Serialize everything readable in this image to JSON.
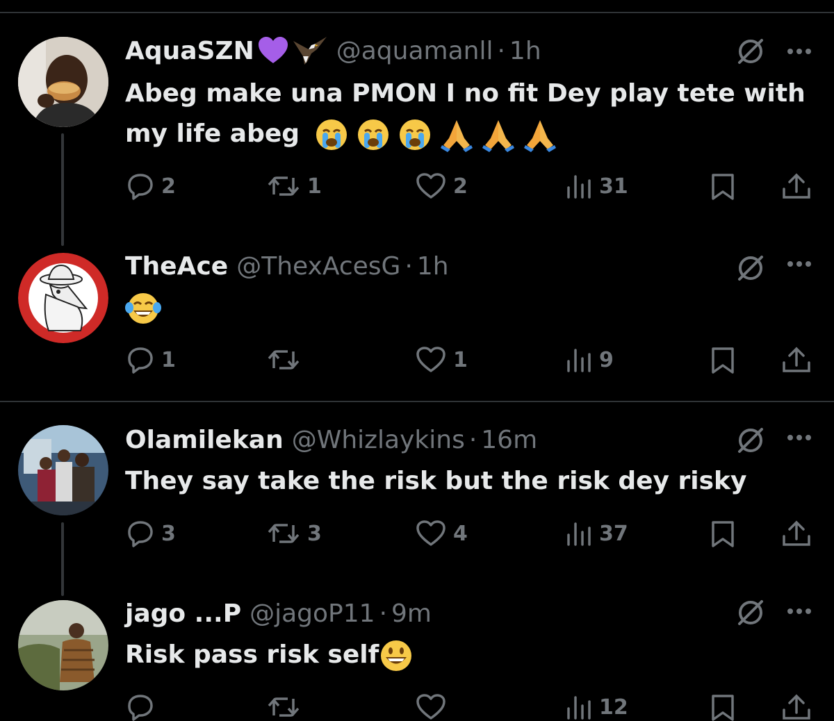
{
  "tweets": [
    {
      "name": "AquaSZN",
      "handle": "@aquamanll",
      "dot": "·",
      "time": "1h",
      "text": "Abeg make una PMON I no fit Dey play tete with my life abeg",
      "emojis": [
        "crying-face",
        "crying-face",
        "crying-face",
        "folded-hands",
        "folded-hands",
        "folded-hands"
      ],
      "counts": {
        "replies": "2",
        "reposts": "1",
        "likes": "2",
        "views": "31"
      }
    },
    {
      "name": "TheAce",
      "handle": "@ThexAcesG",
      "dot": "·",
      "time": "1h",
      "text": "",
      "emojis": [
        "tears-of-joy-face"
      ],
      "counts": {
        "replies": "1",
        "reposts": "",
        "likes": "1",
        "views": "9"
      }
    },
    {
      "name": "Olamilekan",
      "handle": "@Whizlaykins",
      "dot": "·",
      "time": "16m",
      "text": "They say take the risk but the risk dey risky",
      "emojis": [],
      "counts": {
        "replies": "3",
        "reposts": "3",
        "likes": "4",
        "views": "37"
      }
    },
    {
      "name": "jago ...P",
      "handle": "@jagoP11",
      "dot": "·",
      "time": "9m",
      "text": "Risk pass risk self",
      "emojis": [
        "grinning-face"
      ],
      "counts": {
        "replies": "",
        "reposts": "",
        "likes": "",
        "views": "12"
      }
    }
  ],
  "colors": {
    "background": "#000000",
    "text": "#e7e9ea",
    "muted": "#71767b",
    "divider": "#2f3336"
  }
}
